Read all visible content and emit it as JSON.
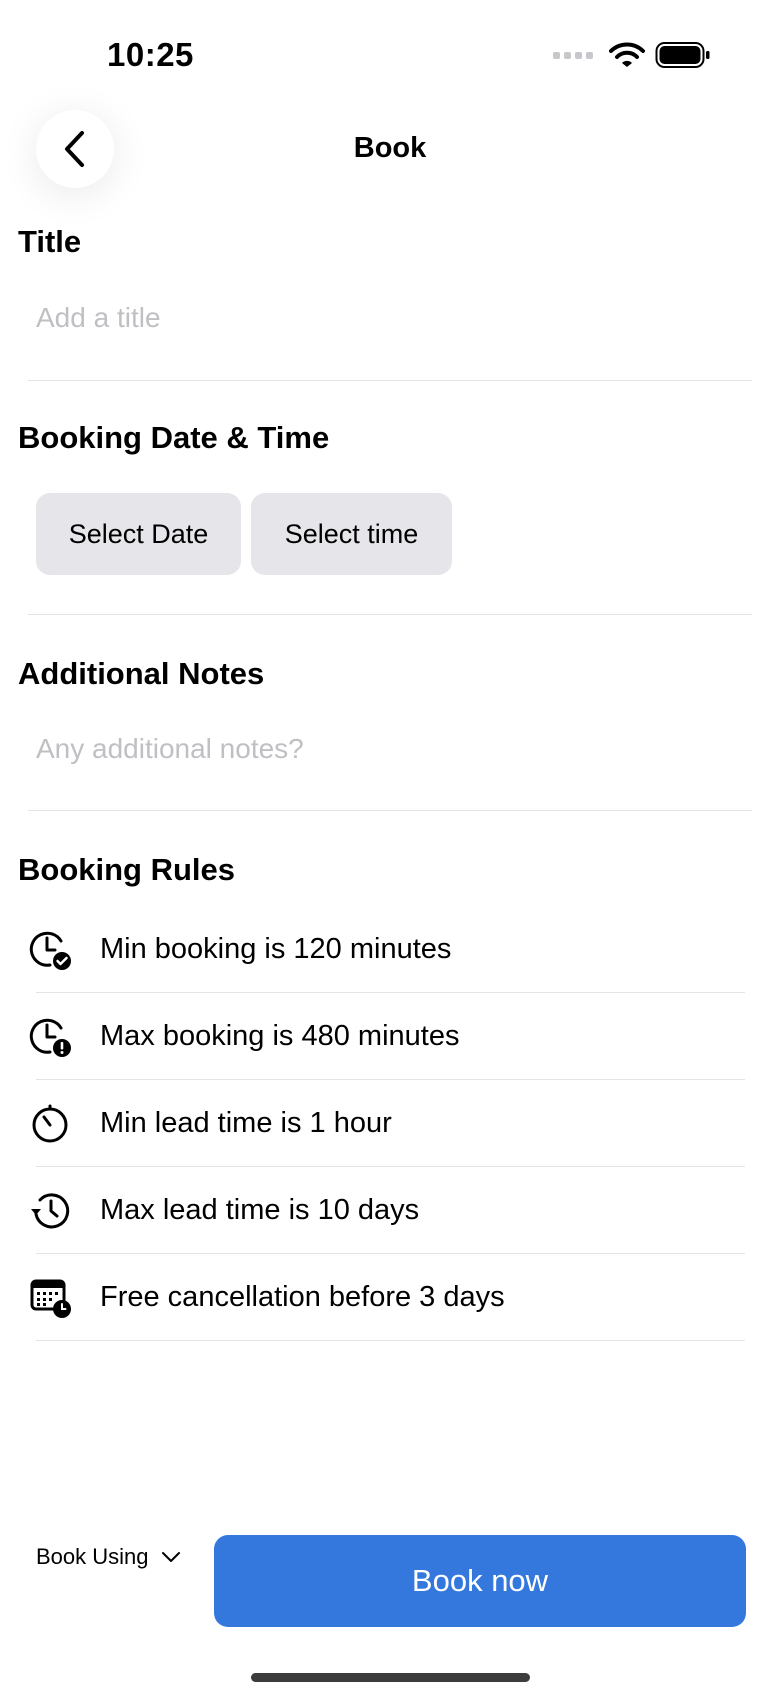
{
  "status_bar": {
    "time": "10:25"
  },
  "nav": {
    "title": "Book"
  },
  "title_section": {
    "label": "Title",
    "placeholder": "Add a title"
  },
  "datetime_section": {
    "label": "Booking Date & Time",
    "select_date": "Select Date",
    "select_time": "Select time"
  },
  "notes_section": {
    "label": "Additional Notes",
    "placeholder": "Any additional notes?"
  },
  "rules_section": {
    "label": "Booking Rules",
    "rules": [
      {
        "icon": "clock-check-icon",
        "text": "Min booking is 120 minutes"
      },
      {
        "icon": "clock-alert-icon",
        "text": "Max booking is 480 minutes"
      },
      {
        "icon": "timer-icon",
        "text": "Min lead time is 1 hour"
      },
      {
        "icon": "history-icon",
        "text": "Max lead time is 10 days"
      },
      {
        "icon": "calendar-clock-icon",
        "text": "Free cancellation before 3 days"
      }
    ]
  },
  "footer": {
    "book_using": "Book Using",
    "book_now": "Book now"
  },
  "colors": {
    "primary": "#3478de",
    "pill_bg": "#e5e5ea",
    "placeholder": "#c0c0c4"
  }
}
